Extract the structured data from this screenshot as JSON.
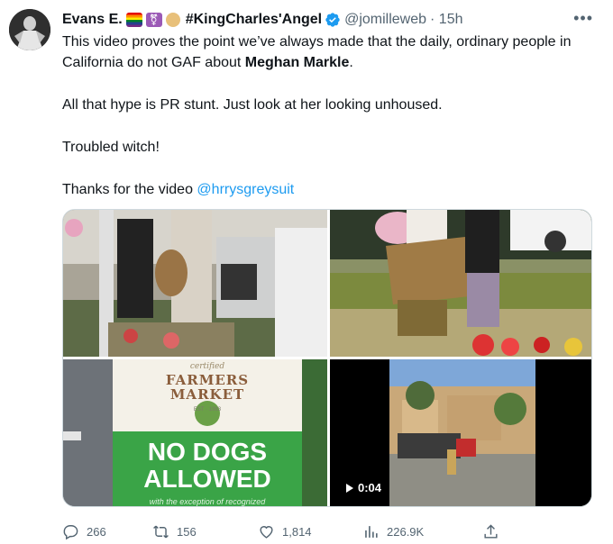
{
  "author": {
    "name": "Evans E.",
    "tag": "#KingCharles'Angel",
    "handle": "@jomilleweb",
    "time": "· 15h"
  },
  "tweet": {
    "line1_a": "This video proves the point we’ve always made that the daily, ordinary people in California do not GAF about ",
    "line1_bold": "Meghan Markle",
    "line1_end": ".",
    "line2": "All that hype is PR stunt.  Just look at her looking unhoused.",
    "line3": "Troubled witch!",
    "line4_a": "Thanks for the video ",
    "line4_mention": "@hrrysgreysuit"
  },
  "media": {
    "sign_top": "certified",
    "sign_brand": "FARMERS MARKET",
    "sign_est": "EST · 1983",
    "sign_main": "NO DOGS ALLOWED",
    "sign_bottom": "with the exception of recognized",
    "video_duration": "0:04"
  },
  "actions": {
    "replies": "266",
    "retweets": "156",
    "likes": "1,814",
    "views": "226.9K"
  },
  "colors": {
    "accent": "#1d9bf0",
    "muted": "#536471",
    "sign_green": "#3aa447"
  }
}
